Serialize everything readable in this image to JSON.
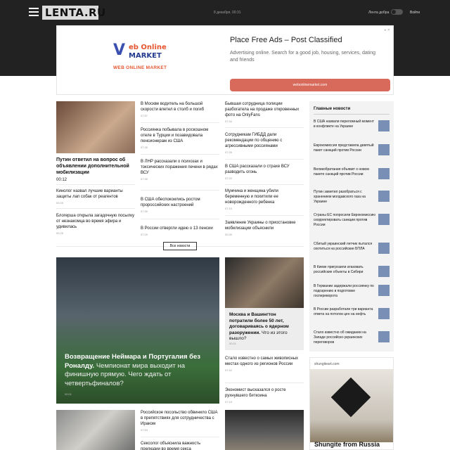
{
  "header": {
    "logo": "LENTA.RU",
    "date": "8 декабря, 00:31",
    "good_feed": "Лента добра",
    "login": "Войти"
  },
  "ad_top": {
    "logo_letter": "V",
    "logo_line1": "eb Online",
    "logo_line2": "MARKET",
    "tagline": "WEB ONLINE MARKET",
    "title": "Place Free Ads – Post Classified",
    "description": "Advertising online. Search for a good job, housing, services, dating and friends",
    "button": "webonlinemarket.com"
  },
  "lead": {
    "title": "Путин ответил на вопрос об объявлении дополнительной мобилизации",
    "time": "00:12"
  },
  "col1": [
    {
      "title": "Кинолог назвал лучшие варианты защиты лап собак от реагентов",
      "time": "00:25"
    },
    {
      "title": "Блогерша открыла загадочную посылку от незнакомца во время эфира и удивилась",
      "time": "00:26"
    }
  ],
  "col2": [
    {
      "title": "В Москве водитель на большой скорости влетел в столб и погиб",
      "time": "07:57"
    },
    {
      "title": "Россиянка побывала в роскошном отеле в Турции и позавидовала пенсионерам из США",
      "time": "07:30"
    },
    {
      "title": "В ЛНР рассказали о психозах и токсических поражения печени в рядах ВСУ",
      "time": "07:30"
    },
    {
      "title": "В США обеспокоились ростом пророссийских настроений",
      "time": "07:30"
    },
    {
      "title": "В России отвергли идею о 13 пенсии",
      "time": "07:29"
    }
  ],
  "col3": [
    {
      "title": "Бывшая сотрудница полиции разбогатела на продаже откровенных фото на OnlyFans",
      "time": "07:34"
    },
    {
      "title": "Сотрудникам ГИБДД дали рекомендации по общению с агрессивными россиянами",
      "time": "07:26"
    },
    {
      "title": "В США рассказали о страхе ВСУ разводить огонь",
      "time": "07:22"
    },
    {
      "title": "Мужчина и женщина убили беременную и похитили ее новорожденного ребенка",
      "time": "07:10"
    },
    {
      "title": "Заявление Украины о приостановке мобилизации объяснили",
      "time": "00:30"
    }
  ],
  "all_news": "Все новости",
  "sidebar": {
    "title": "Главные новости",
    "items": [
      "В США назвали переломный момент в конфликте на Украине",
      "Еврокомиссия представила девятый пакет санкций против России",
      "Великобритания объявит о новом пакете санкций против России",
      "Путин заметил разобраться с хранением молдавского газа на Украине",
      "Страны ЕС попросили Еврокомиссию скорректировать санкции против России",
      "Сбитый украинский летчик пытался охотиться на российские БПЛА",
      "В Киеве пригрозили атаковать российские объекты в Сибири",
      "В Германии задержали россиянку по подозрению в подготовке госпереворота",
      "В России разработали три варианта ответа на потолок цен на нефть",
      "Стало известно об ожидании на Западе российско-украинских переговоров"
    ]
  },
  "feature": {
    "title_bold": "Возвращение Неймара и Португалия без Роналду.",
    "title_rest": " Чемпионат мира выходит на финишную прямую. Чего ждать от четвертьфиналов?",
    "time": "00:01"
  },
  "mid_story": {
    "title_bold": "Москва и Вашингтон потратили более 50 лет, договариваясь о ядерном разоружении.",
    "title_rest": " Что из этого вышло?",
    "time": "00:01"
  },
  "mid_list": [
    {
      "title": "Стало известно о самых живописных местах одного из регионов России",
      "time": "07:42"
    },
    {
      "title": "Экономист высказался о росте рухнувшего биткоина",
      "time": "07:15"
    }
  ],
  "lower_left": [
    {
      "title": "Российское посольство обвинило США в препятствиях для сотрудничества с Ираком",
      "time": "07:53"
    },
    {
      "title": "Сексолог объяснила важность прелюдии во время секса",
      "time": ""
    }
  ],
  "ad_side": {
    "domain": "shungiteart.com",
    "title": "Shungite from Russia"
  }
}
